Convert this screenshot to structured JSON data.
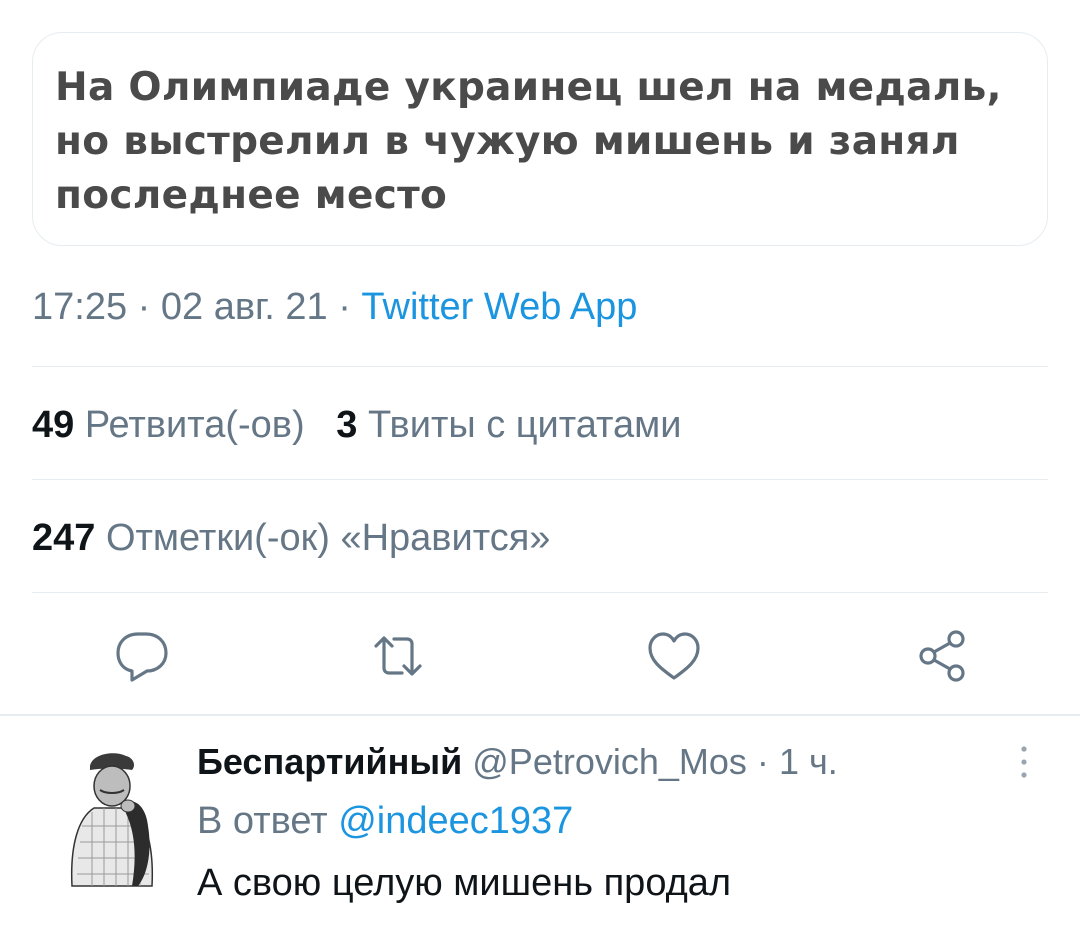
{
  "headline": {
    "lines": [
      "На Олимпиаде украинец шел на медаль,",
      "но выстрелил в чужую мишень и занял",
      "последнее место"
    ]
  },
  "tweet_meta": {
    "time": "17:25",
    "separator": "·",
    "date": "02 авг. 21",
    "source": "Twitter Web App"
  },
  "stats": {
    "retweets_count": "49",
    "retweets_label": "Ретвита(-ов)",
    "quotes_count": "3",
    "quotes_label": "Твиты с цитатами",
    "likes_count": "247",
    "likes_label": "Отметки(-ок) «Нравится»"
  },
  "actions": {
    "icons": [
      "reply-icon",
      "retweet-icon",
      "like-icon",
      "share-icon"
    ],
    "color": "#657786"
  },
  "reply": {
    "author_name": "Беспартийный",
    "author_handle": "@Petrovich_Mos",
    "separator": "·",
    "time_ago": "1 ч.",
    "reply_to_label": "В ответ",
    "reply_to_handle": "@indeec1937",
    "text": "А свою целую мишень продал"
  },
  "colors": {
    "link": "#1b95e0",
    "secondary_text": "#657786",
    "primary_text": "#0f1419",
    "divider": "#e6ecf0"
  }
}
